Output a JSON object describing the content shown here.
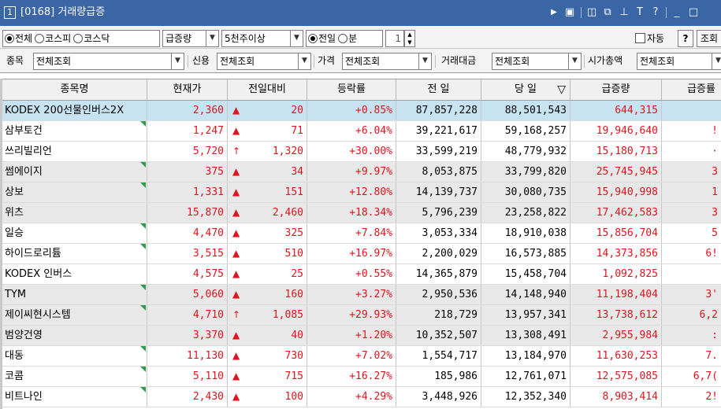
{
  "window": {
    "number": "1",
    "title": "[0168] 거래량급증"
  },
  "toolbar1": {
    "market_options": [
      {
        "label": "전체",
        "selected": true
      },
      {
        "label": "코스피",
        "selected": false
      },
      {
        "label": "코스닥",
        "selected": false
      }
    ],
    "sort_select": "급증량",
    "volume_select": "5천주이상",
    "period_options": [
      {
        "label": "전일",
        "selected": true
      },
      {
        "label": "분",
        "selected": false
      }
    ],
    "minute_value": "1",
    "auto_label": "자동",
    "help_label": "?",
    "query_label": "조회"
  },
  "toolbar2": {
    "item_label": "종목",
    "item_value": "전체조회",
    "credit_label": "신용",
    "credit_value": "전체조회",
    "price_label": "가격",
    "price_value": "전체조회",
    "trade_amount_label": "거래대금",
    "trade_amount_value": "전체조회",
    "market_cap_label": "시가총액",
    "market_cap_value": "전체조회"
  },
  "table": {
    "headers": [
      "종목명",
      "현재가",
      "전일대비",
      "등락률",
      "전 일",
      "당 일",
      "급증량",
      "급증률"
    ],
    "sort_indicator": "▽",
    "rows": [
      {
        "name": "KODEX 200선물인버스2X",
        "price": "2,360",
        "arrow": "▲",
        "change": "20",
        "rate": "+0.85%",
        "prev": "87,857,228",
        "today": "88,501,543",
        "surge": "644,315",
        "surge_rate": "",
        "selected": true,
        "flag": false,
        "shade": false
      },
      {
        "name": "삼부토건",
        "price": "1,247",
        "arrow": "▲",
        "change": "71",
        "rate": "+6.04%",
        "prev": "39,221,617",
        "today": "59,168,257",
        "surge": "19,946,640",
        "surge_rate": "!",
        "selected": false,
        "flag": true,
        "shade": false
      },
      {
        "name": "쓰리빌리언",
        "price": "5,720",
        "arrow": "↑",
        "change": "1,320",
        "rate": "+30.00%",
        "prev": "33,599,219",
        "today": "48,779,932",
        "surge": "15,180,713",
        "surge_rate": "·",
        "selected": false,
        "flag": false,
        "shade": false
      },
      {
        "name": "썸에이지",
        "price": "375",
        "arrow": "▲",
        "change": "34",
        "rate": "+9.97%",
        "prev": "8,053,875",
        "today": "33,799,820",
        "surge": "25,745,945",
        "surge_rate": "3",
        "selected": false,
        "flag": true,
        "shade": true
      },
      {
        "name": "상보",
        "price": "1,331",
        "arrow": "▲",
        "change": "151",
        "rate": "+12.80%",
        "prev": "14,139,737",
        "today": "30,080,735",
        "surge": "15,940,998",
        "surge_rate": "1",
        "selected": false,
        "flag": true,
        "shade": true
      },
      {
        "name": "위츠",
        "price": "15,870",
        "arrow": "▲",
        "change": "2,460",
        "rate": "+18.34%",
        "prev": "5,796,239",
        "today": "23,258,822",
        "surge": "17,462,583",
        "surge_rate": "3",
        "selected": false,
        "flag": false,
        "shade": true
      },
      {
        "name": "일승",
        "price": "4,470",
        "arrow": "▲",
        "change": "325",
        "rate": "+7.84%",
        "prev": "3,053,334",
        "today": "18,910,038",
        "surge": "15,856,704",
        "surge_rate": "5",
        "selected": false,
        "flag": true,
        "shade": false
      },
      {
        "name": "하이드로리튬",
        "price": "3,515",
        "arrow": "▲",
        "change": "510",
        "rate": "+16.97%",
        "prev": "2,200,029",
        "today": "16,573,885",
        "surge": "14,373,856",
        "surge_rate": "6!",
        "selected": false,
        "flag": true,
        "shade": false
      },
      {
        "name": "KODEX 인버스",
        "price": "4,575",
        "arrow": "▲",
        "change": "25",
        "rate": "+0.55%",
        "prev": "14,365,879",
        "today": "15,458,704",
        "surge": "1,092,825",
        "surge_rate": "",
        "selected": false,
        "flag": false,
        "shade": false
      },
      {
        "name": "TYM",
        "price": "5,060",
        "arrow": "▲",
        "change": "160",
        "rate": "+3.27%",
        "prev": "2,950,536",
        "today": "14,148,940",
        "surge": "11,198,404",
        "surge_rate": "3'",
        "selected": false,
        "flag": true,
        "shade": true
      },
      {
        "name": "제이씨현시스템",
        "price": "4,710",
        "arrow": "↑",
        "change": "1,085",
        "rate": "+29.93%",
        "prev": "218,729",
        "today": "13,957,341",
        "surge": "13,738,612",
        "surge_rate": "6,2",
        "selected": false,
        "flag": true,
        "shade": true
      },
      {
        "name": "범양건영",
        "price": "3,370",
        "arrow": "▲",
        "change": "40",
        "rate": "+1.20%",
        "prev": "10,352,507",
        "today": "13,308,491",
        "surge": "2,955,984",
        "surge_rate": ":",
        "selected": false,
        "flag": false,
        "shade": true
      },
      {
        "name": "대동",
        "price": "11,130",
        "arrow": "▲",
        "change": "730",
        "rate": "+7.02%",
        "prev": "1,554,717",
        "today": "13,184,970",
        "surge": "11,630,253",
        "surge_rate": "7.",
        "selected": false,
        "flag": true,
        "shade": false
      },
      {
        "name": "코콤",
        "price": "5,110",
        "arrow": "▲",
        "change": "715",
        "rate": "+16.27%",
        "prev": "185,986",
        "today": "12,761,071",
        "surge": "12,575,085",
        "surge_rate": "6,7(",
        "selected": false,
        "flag": true,
        "shade": false
      },
      {
        "name": "비트나인",
        "price": "2,430",
        "arrow": "▲",
        "change": "100",
        "rate": "+4.29%",
        "prev": "3,448,926",
        "today": "12,352,340",
        "surge": "8,903,414",
        "surge_rate": "2!",
        "selected": false,
        "flag": true,
        "shade": false
      }
    ]
  }
}
